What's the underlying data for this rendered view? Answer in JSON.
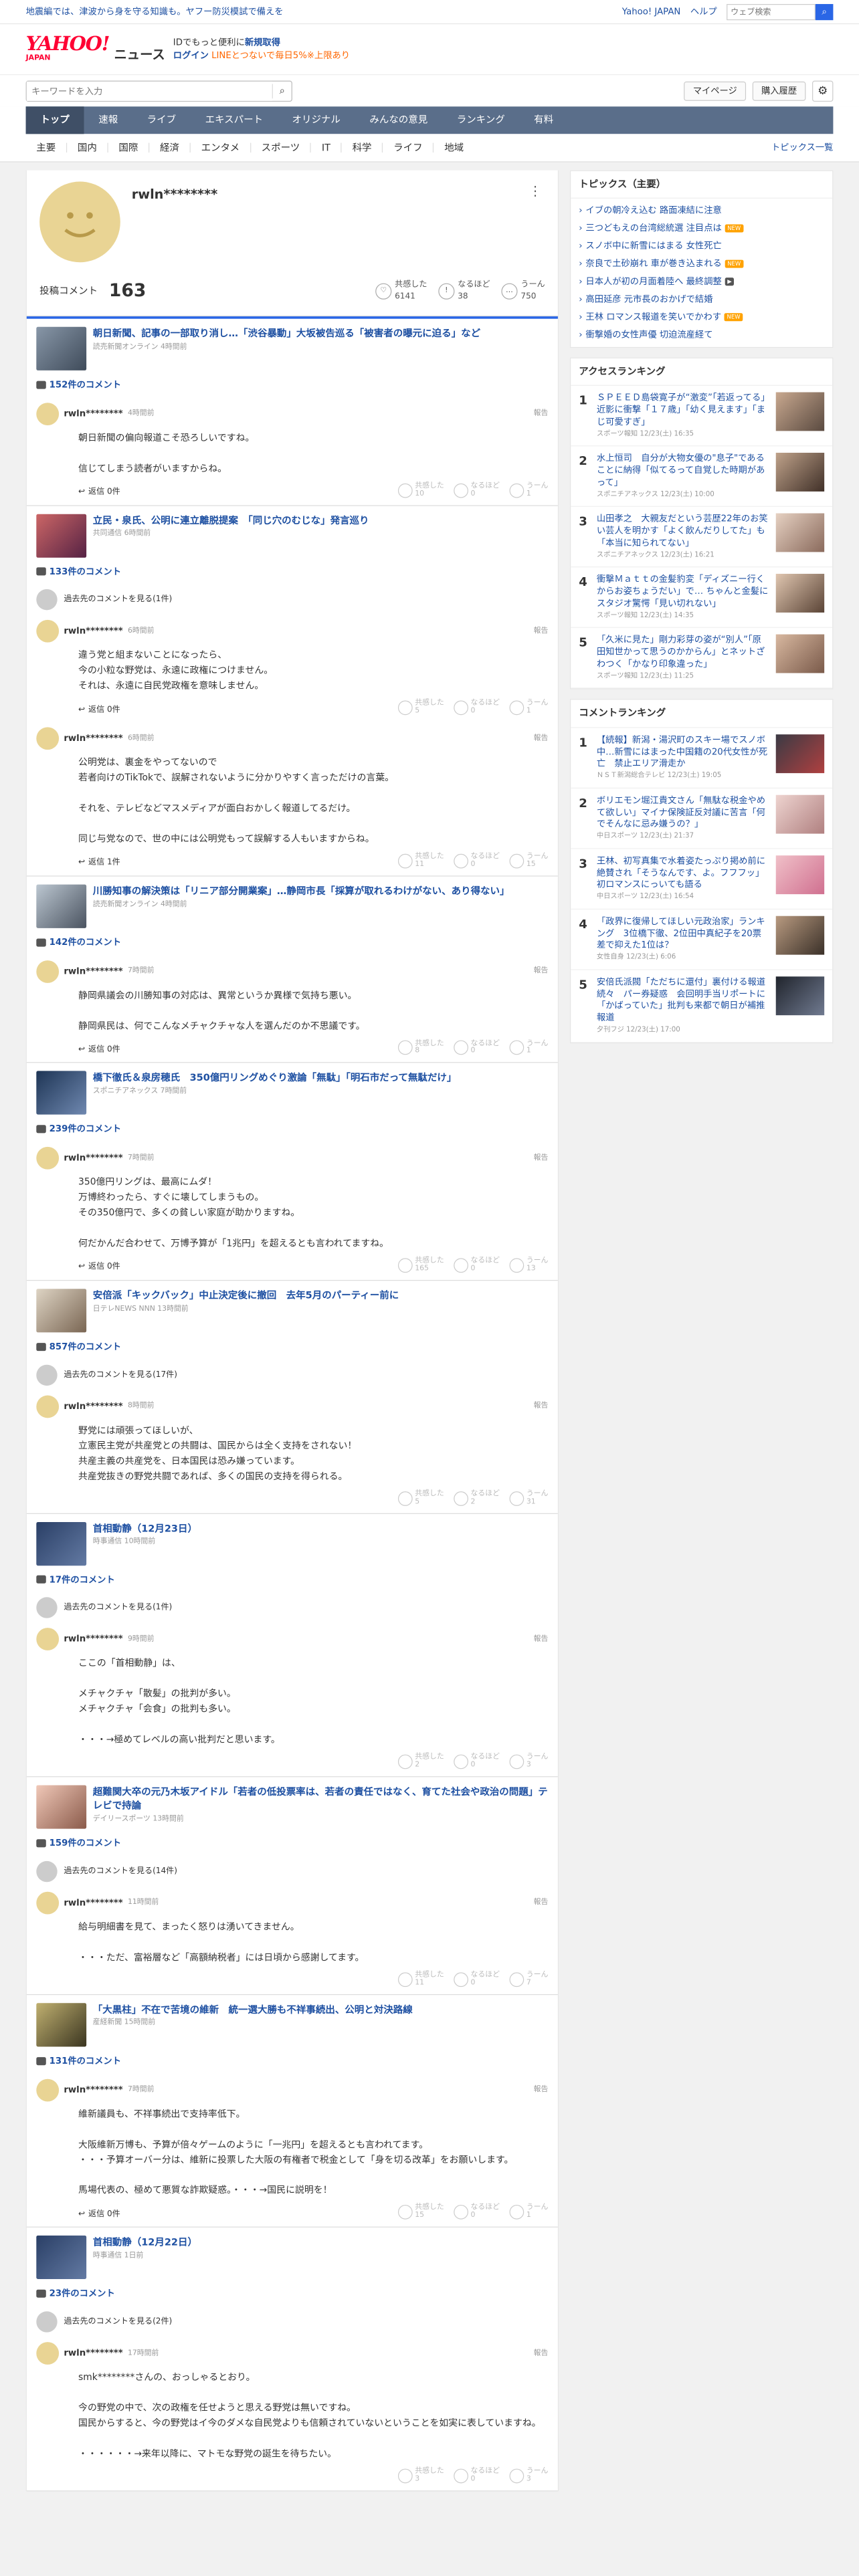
{
  "promo": {
    "text": "地震編では、津波から身を守る知識も。ヤフー防災模試で備えを",
    "yj": "Yahoo! JAPAN",
    "help": "ヘルプ",
    "search_placeholder": "ウェブ検索"
  },
  "masthead": {
    "logo": "YAHOO!",
    "logo_sub": "JAPAN",
    "service": "ニュース",
    "login_line1_pre": "IDでもっと便利に",
    "login_line1_link": "新規取得",
    "login_link": "ログイン",
    "login_line2": "LINEとつないで毎日5%※上限あり"
  },
  "searchbar": {
    "placeholder": "キーワードを入力",
    "mypage": "マイページ",
    "history": "購入履歴"
  },
  "gnav": [
    "トップ",
    "速報",
    "ライブ",
    "エキスパート",
    "オリジナル",
    "みんなの意見",
    "ランキング",
    "有料"
  ],
  "subnav": {
    "items": [
      "主要",
      "国内",
      "国際",
      "経済",
      "エンタメ",
      "スポーツ",
      "IT",
      "科学",
      "ライフ",
      "地域"
    ],
    "topics_link": "トピックス一覧"
  },
  "profile": {
    "username": "rwln********",
    "posted_label": "投稿コメント",
    "posted_count": "163",
    "kyokan_label": "共感した",
    "kyokan_count": "6141",
    "naruhodo_label": "なるほど",
    "naruhodo_count": "38",
    "uun_label": "うーん",
    "uun_count": "750"
  },
  "blocks": [
    {
      "title": "朝日新聞、記事の一部取り消し…「渋谷暴動」大坂被告巡る「被害者の曝元に迫る」など",
      "source": "読売新聞オンライン 4時間前",
      "count": "152件のコメント",
      "prev": "",
      "comments": [
        {
          "user": "rwln********",
          "time": "4時間前",
          "body": "朝日新聞の偏向報道こそ恐ろしいですね。\n\n信じてしまう読者がいますからね。",
          "reply": "返信 0件",
          "kyokan": "10",
          "naruhodo": "0",
          "uun": "1"
        }
      ]
    },
    {
      "title": "立民・泉氏、公明に連立離脱提案　「同じ穴のむじな」発言巡り",
      "source": "共同通信 6時間前",
      "count": "133件のコメント",
      "prev": "過去先のコメントを見る(1件)",
      "comments": [
        {
          "user": "rwln********",
          "time": "6時間前",
          "body": "違う党と組まないことになったら、\n今の小粒な野党は、永遠に政権につけません。\nそれは、永遠に自民党政権を意味しません。",
          "reply": "返信 0件",
          "kyokan": "5",
          "naruhodo": "0",
          "uun": "1"
        },
        {
          "user": "rwln********",
          "time": "6時間前",
          "body": "公明党は、裏金をやってないので\n若者向けのTikTokで、誤解されないように分かりやすく言っただけの言葉。\n\nそれを、テレビなどマスメディアが面白おかしく報道してるだけ。\n\n同じ与党なので、世の中には公明党もって誤解する人もいますからね。",
          "reply": "返信 1件",
          "kyokan": "11",
          "naruhodo": "0",
          "uun": "15"
        }
      ]
    },
    {
      "title": "川勝知事の解決策は「リニア部分開業案」…静岡市長「採算が取れるわけがない、あり得ない」",
      "source": "読売新聞オンライン 4時間前",
      "count": "142件のコメント",
      "prev": "",
      "comments": [
        {
          "user": "rwln********",
          "time": "7時間前",
          "body": "静岡県議会の川勝知事の対応は、異常というか異様で気持ち悪い。\n\n静岡県民は、何でこんなメチャクチャな人を選んだのか不思議です。",
          "reply": "返信 0件",
          "kyokan": "8",
          "naruhodo": "0",
          "uun": "1"
        }
      ]
    },
    {
      "title": "橋下徹氏＆泉房穂氏　350億円リングめぐり激論「無駄」「明石市だって無駄だけ」",
      "source": "スポニチアネックス 7時間前",
      "count": "239件のコメント",
      "prev": "",
      "comments": [
        {
          "user": "rwln********",
          "time": "7時間前",
          "body": "350億円リングは、最高にムダ！\n万博終わったら、すぐに壊してしまうもの。\nその350億円で、多くの貧しい家庭が助かりますね。\n\n何だかんだ合わせて、万博予算が「1兆円」を超えるとも言われてますね。",
          "reply": "返信 0件",
          "kyokan": "165",
          "naruhodo": "0",
          "uun": "13"
        }
      ]
    },
    {
      "title": "安倍派「キックバック」中止決定後に撤回　去年5月のパーティー前に",
      "source": "日テレNEWS NNN 13時間前",
      "count": "857件のコメント",
      "prev": "過去先のコメントを見る(17件)",
      "comments": [
        {
          "user": "rwln********",
          "time": "8時間前",
          "body": "野党には頑張ってほしいが、\n立憲民主党が共産党との共闘は、国民からは全く支持をされない！\n共産主義の共産党を、日本国民は恐み嫌っています。\n共産党抜きの野党共闘であれば、多くの国民の支持を得られる。",
          "reply": "",
          "kyokan": "5",
          "naruhodo": "2",
          "uun": "31"
        }
      ]
    },
    {
      "title": "首相動静（12月23日）",
      "source": "時事通信 10時間前",
      "count": "17件のコメント",
      "prev": "過去先のコメントを見る(1件)",
      "comments": [
        {
          "user": "rwln********",
          "time": "9時間前",
          "body": "ここの「首相動静」は、\n\nメチャクチャ「散髪」の批判が多い。\nメチャクチャ「会食」の批判も多い。\n\n・・・→極めてレベルの高い批判だと思います。",
          "reply": "",
          "kyokan": "2",
          "naruhodo": "0",
          "uun": "3"
        }
      ]
    },
    {
      "title": "超難関大卒の元乃木坂アイドル「若者の低投票率は、若者の責任ではなく、育てた社会や政治の問題」テレビで持論",
      "source": "デイリースポーツ 13時間前",
      "count": "159件のコメント",
      "prev": "過去先のコメントを見る(14件)",
      "comments": [
        {
          "user": "rwln********",
          "time": "11時間前",
          "body": "給与明細書を見て、まったく怒りは湧いてきません。\n\n・・・ただ、富裕層など「高額納税者」には日頃から感謝してます。",
          "reply": "",
          "kyokan": "11",
          "naruhodo": "0",
          "uun": "7"
        }
      ]
    },
    {
      "title": "「大黒柱」不在で苦境の維新　統一選大勝も不祥事続出、公明と対決路線",
      "source": "産経新聞 15時間前",
      "count": "131件のコメント",
      "prev": "",
      "comments": [
        {
          "user": "rwln********",
          "time": "7時間前",
          "body": "維新議員も、不祥事続出で支持率低下。\n\n大阪維新万博も、予算が倍々ゲームのように「一兆円」を超えるとも言われてます。\n・・・予算オーバー分は、維新に投票した大阪の有権者で税金として「身を切る改革」をお願いします。\n\n馬場代表の、極めて悪質な詐欺疑惑。・・・→国民に説明を！",
          "reply": "返信 0件",
          "kyokan": "15",
          "naruhodo": "0",
          "uun": "1"
        }
      ]
    },
    {
      "title": "首相動静（12月22日）",
      "source": "時事通信 1日前",
      "count": "23件のコメント",
      "prev": "過去先のコメントを見る(2件)",
      "comments": [
        {
          "user": "rwln********",
          "time": "17時間前",
          "body": "smk********さんの、おっしゃるとおり。\n\n今の野党の中で、次の政権を任せようと思える野党は無いですね。\n国民からすると、今の野党はイ今のダメな自民党よりも信頼されていないということを如実に表していますね。\n\n・・・・・・→来年以降に、マトモな野党の誕生を待ちたい。",
          "reply": "",
          "kyokan": "3",
          "naruhodo": "0",
          "uun": "3"
        }
      ]
    }
  ],
  "side": {
    "topics_title": "トピックス（主要）",
    "topics": [
      {
        "text": "イブの朝冷え込む 路面凍結に注意",
        "badge": ""
      },
      {
        "text": "三つどもえの台湾総統選 注目点は",
        "badge": "NEW"
      },
      {
        "text": "スノボ中に新雪にはまる 女性死亡",
        "badge": ""
      },
      {
        "text": "奈良で土砂崩れ 車が巻き込まれる",
        "badge": "NEW"
      },
      {
        "text": "日本人が初の月面着陸へ 最終調整",
        "badge": "▶"
      },
      {
        "text": "高田延彦 元市長のおかげで結婚",
        "badge": ""
      },
      {
        "text": "王林 ロマンス報道を笑いでかわす",
        "badge": "NEW"
      },
      {
        "text": "衝撃婚の女性声優 切迫流産経て",
        "badge": ""
      }
    ],
    "access_title": "アクセスランキング",
    "access": [
      {
        "n": "1",
        "text": "ＳＰＥＥＤ島袋寛子が“激変”「若返ってる」近影に衝撃「１７歳」「幼く見えます」「まじ可愛すぎ」",
        "src": "スポーツ報知 12/23(土) 16:35"
      },
      {
        "n": "2",
        "text": "水上恒司　自分が大物女優の\"息子\"であることに納得「似てるって自覚した時期があって」",
        "src": "スポニチアネックス 12/23(土) 10:00"
      },
      {
        "n": "3",
        "text": "山田孝之　大親友だという芸歴22年のお笑い芸人を明かす「よく飲んだりしてた」も「本当に知られてない」",
        "src": "スポニチアネックス 12/23(土) 16:21"
      },
      {
        "n": "4",
        "text": "衝撃Ｍａｔｔの金髪豹変「ディズニー行くからお姿ちょうだい」で… ちゃんと金髪にスタジオ驚愕「見い切れない」",
        "src": "スポーツ報知 12/23(土) 14:35"
      },
      {
        "n": "5",
        "text": "「久米に見た」剛力彩芽の姿が“別人”「原田知世かって思うのかからん」とネットざわつく「かなり印象違った」",
        "src": "スポーツ報知 12/23(土) 11:25"
      }
    ],
    "comment_title": "コメントランキング",
    "comment": [
      {
        "n": "1",
        "text": "【続報】新潟・湯沢町のスキー場でスノボ中…新雪にはまった中国籍の20代女性が死亡　禁止エリア滑走か",
        "src": "ＮＳＴ新潟総合テレビ 12/23(土) 19:05"
      },
      {
        "n": "2",
        "text": "ボリエモン堀江貴文さん「無駄な税金やめて欲しい」マイナ保険証反対議に苦言「何でそんなに忌み嫌うの？」",
        "src": "中日スポーツ 12/23(土) 21:37"
      },
      {
        "n": "3",
        "text": "王林、初写真集で水着姿たっぷり掲め前に絶賛され「そうなんです、よ。フフフッ」初ロマンスにっいても語る",
        "src": "中日スポーツ 12/23(土) 16:54"
      },
      {
        "n": "4",
        "text": "「政界に復帰してほしい元政治家」ランキング　3位橋下徹、2位田中真紀子を20票差で抑えた1位は？",
        "src": "女性自身 12/23(土) 6:06"
      },
      {
        "n": "5",
        "text": "安倍氏派閥「ただちに還付」裏付ける報道続々　パー券疑惑　会回明手当リポートに「かばっていた」批判も来都で朝日が補推報道",
        "src": "夕刊フジ 12/23(土) 17:00"
      }
    ]
  },
  "colors": {
    "accent": "#2a66e6",
    "nav": "#5a6e8a",
    "link": "#1e50a2",
    "logo": "#ff0033"
  }
}
